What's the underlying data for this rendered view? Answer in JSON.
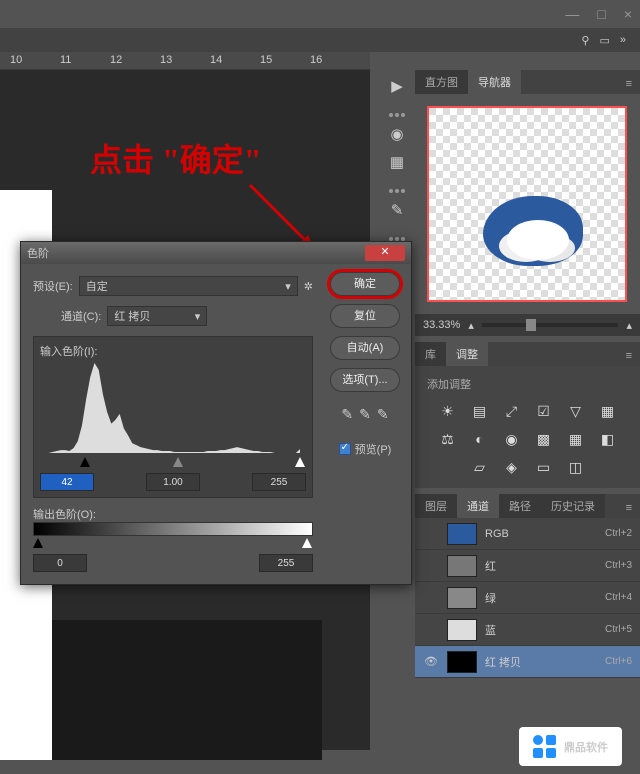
{
  "window": {
    "minimize": "—",
    "restore": "□",
    "close": "×"
  },
  "ruler": {
    "t10": "10",
    "t11": "11",
    "t12": "12",
    "t13": "13",
    "t14": "14",
    "t15": "15",
    "t16": "16"
  },
  "annotation": "点击 \"确定\"",
  "nav_tabs": {
    "histogram": "直方图",
    "navigator": "导航器"
  },
  "zoom_pct": "33.33%",
  "adj_tabs": {
    "lib": "库",
    "adjust": "调整"
  },
  "adj_title": "添加调整",
  "ch_tabs": {
    "layers": "图层",
    "channels": "通道",
    "paths": "路径",
    "history": "历史记录"
  },
  "channels": [
    {
      "name": "RGB",
      "short": "Ctrl+2",
      "bg": "#2b5b9e"
    },
    {
      "name": "红",
      "short": "Ctrl+3",
      "bg": "#777"
    },
    {
      "name": "绿",
      "short": "Ctrl+4",
      "bg": "#888"
    },
    {
      "name": "蓝",
      "short": "Ctrl+5",
      "bg": "#ddd"
    },
    {
      "name": "红 拷贝",
      "short": "Ctrl+6",
      "bg": "#000"
    }
  ],
  "levels": {
    "title": "色阶",
    "preset_label": "预设(E):",
    "preset_value": "自定",
    "channel_label": "通道(C):",
    "channel_value": "红 拷贝",
    "input_label": "输入色阶(I):",
    "output_label": "输出色阶(O):",
    "in_black": "42",
    "in_mid": "1.00",
    "in_white": "255",
    "out_black": "0",
    "out_white": "255",
    "btn_ok": "确定",
    "btn_reset": "复位",
    "btn_auto": "自动(A)",
    "btn_options": "选项(T)...",
    "preview": "预览(P)",
    "close": "✕"
  },
  "watermark": "鼎品软件",
  "chart_data": {
    "type": "histogram",
    "title": "输入色阶",
    "xlabel": "",
    "ylabel": "",
    "xlim": [
      0,
      255
    ],
    "ylim": [
      0,
      100
    ],
    "sliders": {
      "black": 42,
      "mid": 1.0,
      "white": 255
    },
    "output": {
      "black": 0,
      "white": 255
    },
    "values": [
      0,
      0,
      0,
      1,
      2,
      3,
      3,
      2,
      5,
      12,
      28,
      55,
      78,
      92,
      85,
      60,
      42,
      30,
      34,
      40,
      25,
      18,
      10,
      8,
      6,
      5,
      4,
      3,
      3,
      2,
      2,
      2,
      1,
      1,
      1,
      1,
      1,
      1,
      1,
      1,
      2,
      2,
      2,
      3,
      3,
      4,
      5,
      6,
      5,
      4,
      3,
      2,
      2,
      1,
      1,
      1,
      0,
      0,
      0,
      0,
      0,
      0,
      4
    ]
  }
}
